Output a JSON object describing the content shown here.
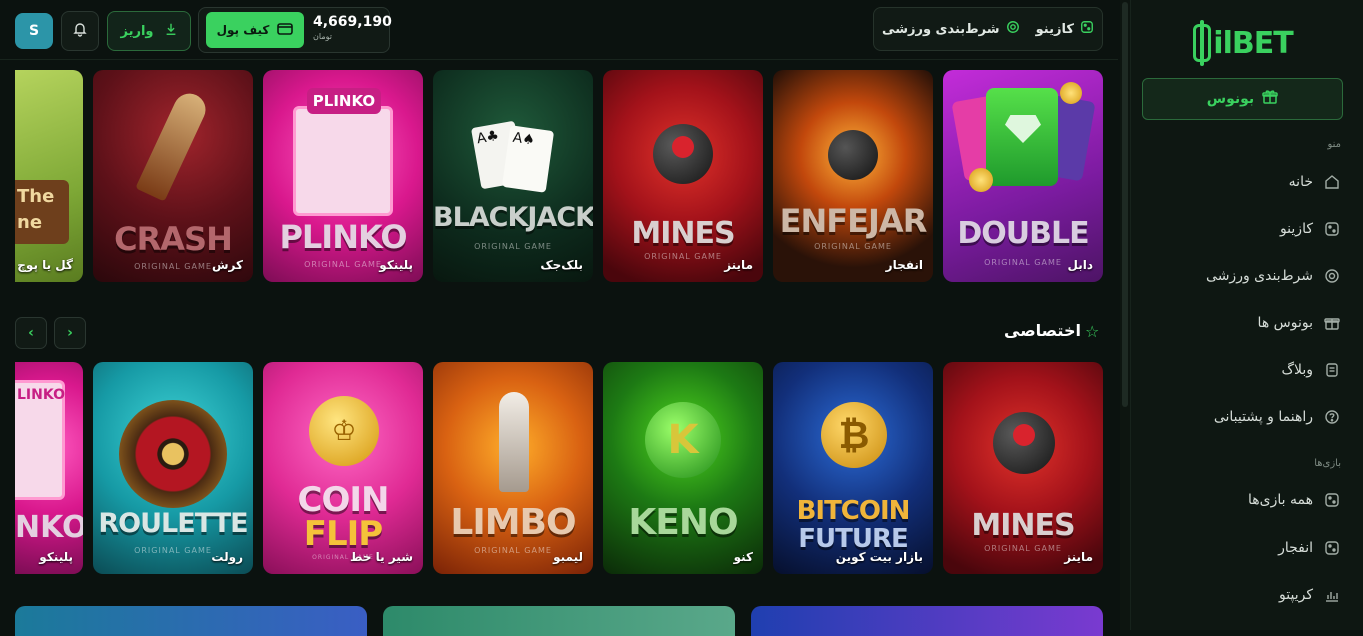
{
  "brand": {
    "logo_text": "ilBET"
  },
  "sidebar": {
    "bonus_label": "بونوس",
    "menu_label": "منو",
    "games_label": "بازی‌ها",
    "menu_items": [
      {
        "label": "خانه",
        "icon": "home-icon"
      },
      {
        "label": "کازینو",
        "icon": "dice-icon"
      },
      {
        "label": "شرط‌بندی ورزشی",
        "icon": "ball-icon"
      },
      {
        "label": "بونوس ها",
        "icon": "gift-icon"
      },
      {
        "label": "وبلاگ",
        "icon": "document-icon"
      },
      {
        "label": "راهنما و پشتیبانی",
        "icon": "help-icon"
      }
    ],
    "game_items": [
      {
        "label": "همه بازی‌ها",
        "icon": "dice-icon"
      },
      {
        "label": "انفجار",
        "icon": "dice-icon"
      },
      {
        "label": "کریپتو",
        "icon": "chart-icon"
      }
    ]
  },
  "topbar": {
    "nav": {
      "casino": "کازینو",
      "sports": "شرط‌بندی ورزشی"
    },
    "wallet_label": "کیف پول",
    "balance": "4,669,190",
    "currency": "تومان",
    "deposit_label": "واریز",
    "avatar_letter": "S"
  },
  "row1": [
    {
      "label": "دابل",
      "title": "DOUBLE",
      "sub": "ORIGINAL GAME"
    },
    {
      "label": "انفجار",
      "title": "ENFEJAR",
      "sub": "ORIGINAL GAME"
    },
    {
      "label": "ماینز",
      "title": "MINES",
      "sub": "ORIGINAL GAME"
    },
    {
      "label": "بلک‌جک",
      "title": "BLACKJACK",
      "sub": "ORIGINAL GAME"
    },
    {
      "label": "پلینکو",
      "title": "PLINKO",
      "sub": "ORIGINAL GAME",
      "top": "PLINKO"
    },
    {
      "label": "کرش",
      "title": "CRASH",
      "sub": "ORIGINAL GAME"
    },
    {
      "label": "گل یا پوچ",
      "title": "The ne"
    }
  ],
  "section": {
    "title": "اختصاصی"
  },
  "row2": [
    {
      "label": "ماینز",
      "title": "MINES",
      "sub": "ORIGINAL GAME"
    },
    {
      "label": "بازار بیت کوین",
      "title": "BITCOIN",
      "title2": "FUTURE"
    },
    {
      "label": "کنو",
      "title": "KENO"
    },
    {
      "label": "لیمبو",
      "title": "LIMBO",
      "sub": "ORIGINAL GAME"
    },
    {
      "label": "شیر یا خط",
      "title": "COIN",
      "title2": "FLIP",
      "sub": "ORIGINAL GAME"
    },
    {
      "label": "رولت",
      "title": "ROULETTE",
      "sub": "ORIGINAL GAME"
    },
    {
      "label": "پلینکو",
      "title": "NKO",
      "top": "LINKO"
    }
  ]
}
